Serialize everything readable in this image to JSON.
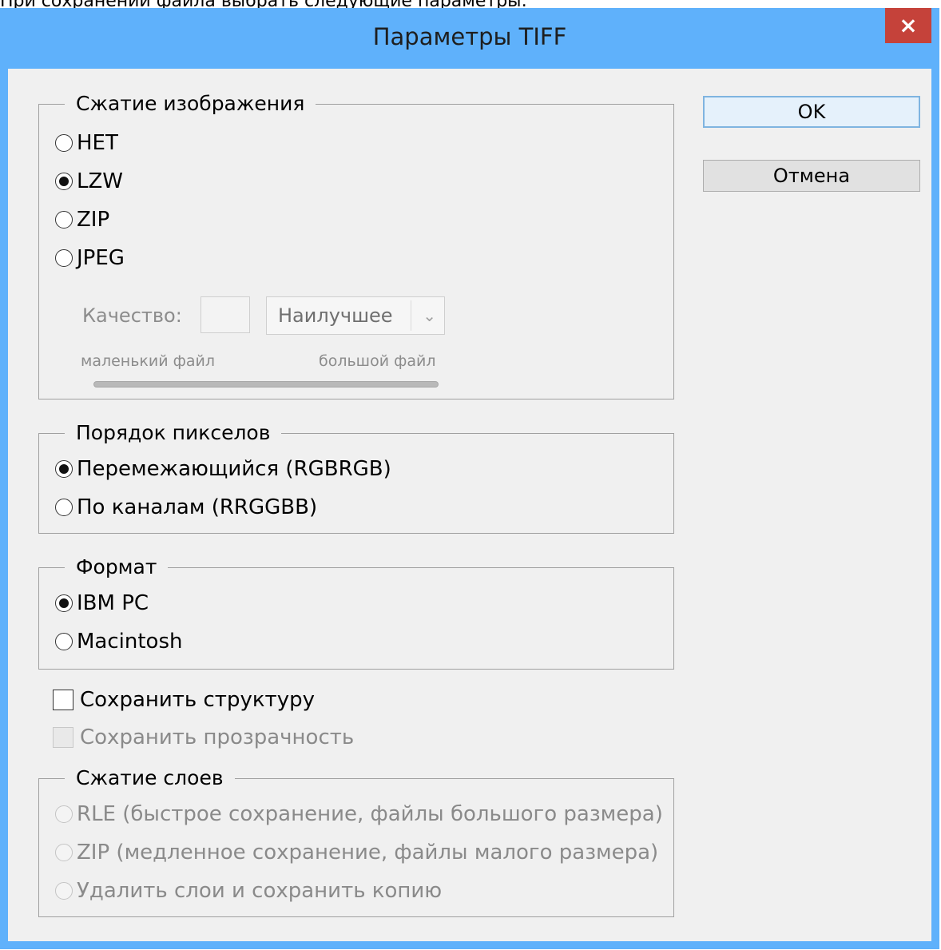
{
  "caption": "При сохранении файла выбрать следующие параметры:",
  "window": {
    "title": "Параметры TIFF",
    "close_glyph": "×",
    "title_bar_color": "#5fb1fb",
    "close_button_color": "#c5423a"
  },
  "image_compression": {
    "legend": "Сжатие изображения",
    "options": [
      {
        "label": "НЕТ",
        "checked": false
      },
      {
        "label": "LZW",
        "checked": true
      },
      {
        "label": "ZIP",
        "checked": false
      },
      {
        "label": "JPEG",
        "checked": false
      }
    ],
    "quality_label": "Качество:",
    "quality_value": "",
    "quality_select": "Наилучшее",
    "small_file_label": "маленький файл",
    "big_file_label": "большой файл"
  },
  "pixel_order": {
    "legend": "Порядок пикселов",
    "options": [
      {
        "label": "Перемежающийся (RGBRGB)",
        "checked": true
      },
      {
        "label": "По каналам (RRGGBB)",
        "checked": false
      }
    ]
  },
  "byte_order": {
    "legend": "Формат",
    "options": [
      {
        "label": "IBM PC",
        "checked": true
      },
      {
        "label": "Macintosh",
        "checked": false
      }
    ]
  },
  "save_structure": {
    "label": "Сохранить структуру",
    "checked": false
  },
  "save_transparency": {
    "label": "Сохранить прозрачность",
    "checked": false,
    "disabled": true
  },
  "layer_compression": {
    "legend": "Сжатие слоев",
    "options": [
      {
        "label": "RLE (быстрое сохранение, файлы большого размера)",
        "checked": false,
        "disabled": true
      },
      {
        "label": "ZIP (медленное сохранение, файлы малого размера)",
        "checked": false,
        "disabled": true
      },
      {
        "label": "Удалить слои и сохранить копию",
        "checked": false,
        "disabled": true
      }
    ]
  },
  "buttons": {
    "ok": "OK",
    "cancel": "Отмена"
  }
}
